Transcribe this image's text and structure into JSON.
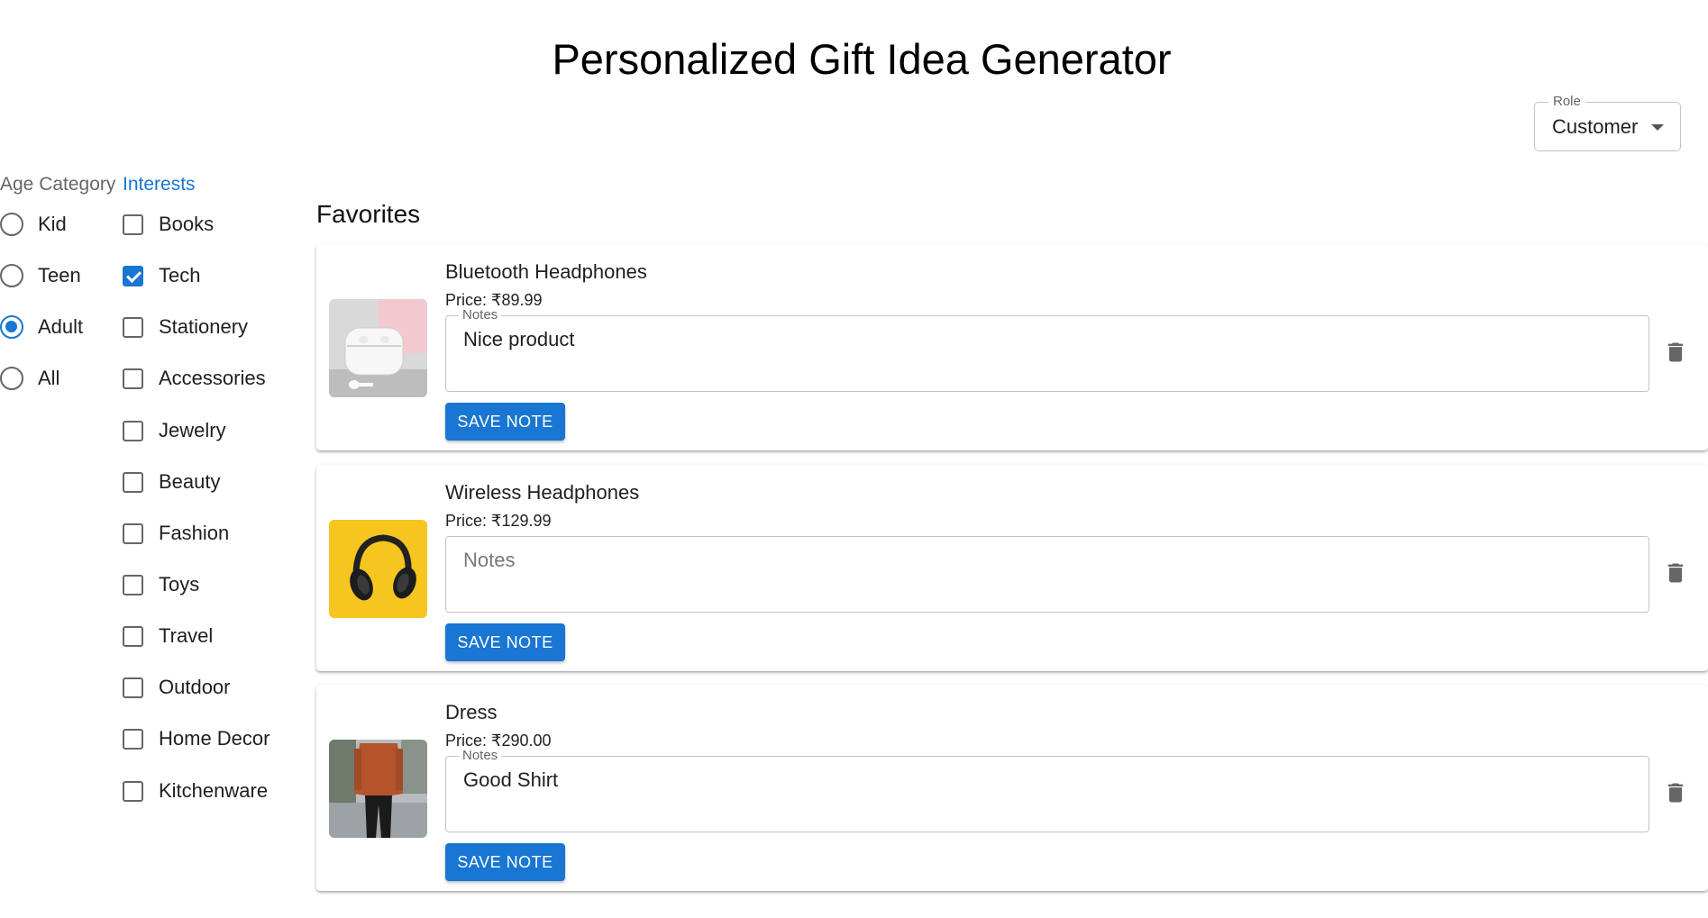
{
  "header": {
    "title": "Personalized Gift Idea Generator"
  },
  "role_select": {
    "label": "Role",
    "value": "Customer"
  },
  "filters": {
    "age_legend": "Age Category",
    "interests_legend": "Interests",
    "age_options": [
      {
        "label": "Kid",
        "selected": false
      },
      {
        "label": "Teen",
        "selected": false
      },
      {
        "label": "Adult",
        "selected": true
      },
      {
        "label": "All",
        "selected": false
      }
    ],
    "interests": [
      {
        "label": "Books",
        "checked": false
      },
      {
        "label": "Tech",
        "checked": true
      },
      {
        "label": "Stationery",
        "checked": false
      },
      {
        "label": "Accessories",
        "checked": false
      },
      {
        "label": "Jewelry",
        "checked": false
      },
      {
        "label": "Beauty",
        "checked": false
      },
      {
        "label": "Fashion",
        "checked": false
      },
      {
        "label": "Toys",
        "checked": false
      },
      {
        "label": "Travel",
        "checked": false
      },
      {
        "label": "Outdoor",
        "checked": false
      },
      {
        "label": "Home Decor",
        "checked": false
      },
      {
        "label": "Kitchenware",
        "checked": false
      }
    ]
  },
  "favorites": {
    "title": "Favorites",
    "items": [
      {
        "name": "Bluetooth Headphones",
        "price": "Price: ₹89.99",
        "notes_label": "Notes",
        "notes_value": "Nice product",
        "save_label": "SAVE NOTE",
        "image": "earbuds-image"
      },
      {
        "name": "Wireless Headphones",
        "price": "Price: ₹129.99",
        "notes_label": "Notes",
        "notes_value": "",
        "save_label": "SAVE NOTE",
        "image": "headphones-image"
      },
      {
        "name": "Dress",
        "price": "Price: ₹290.00",
        "notes_label": "Notes",
        "notes_value": "Good Shirt",
        "save_label": "SAVE NOTE",
        "image": "shirt-model-image"
      }
    ]
  },
  "colors": {
    "primary": "#1976d2",
    "border": "#c4c4c4",
    "icon": "#666666"
  }
}
